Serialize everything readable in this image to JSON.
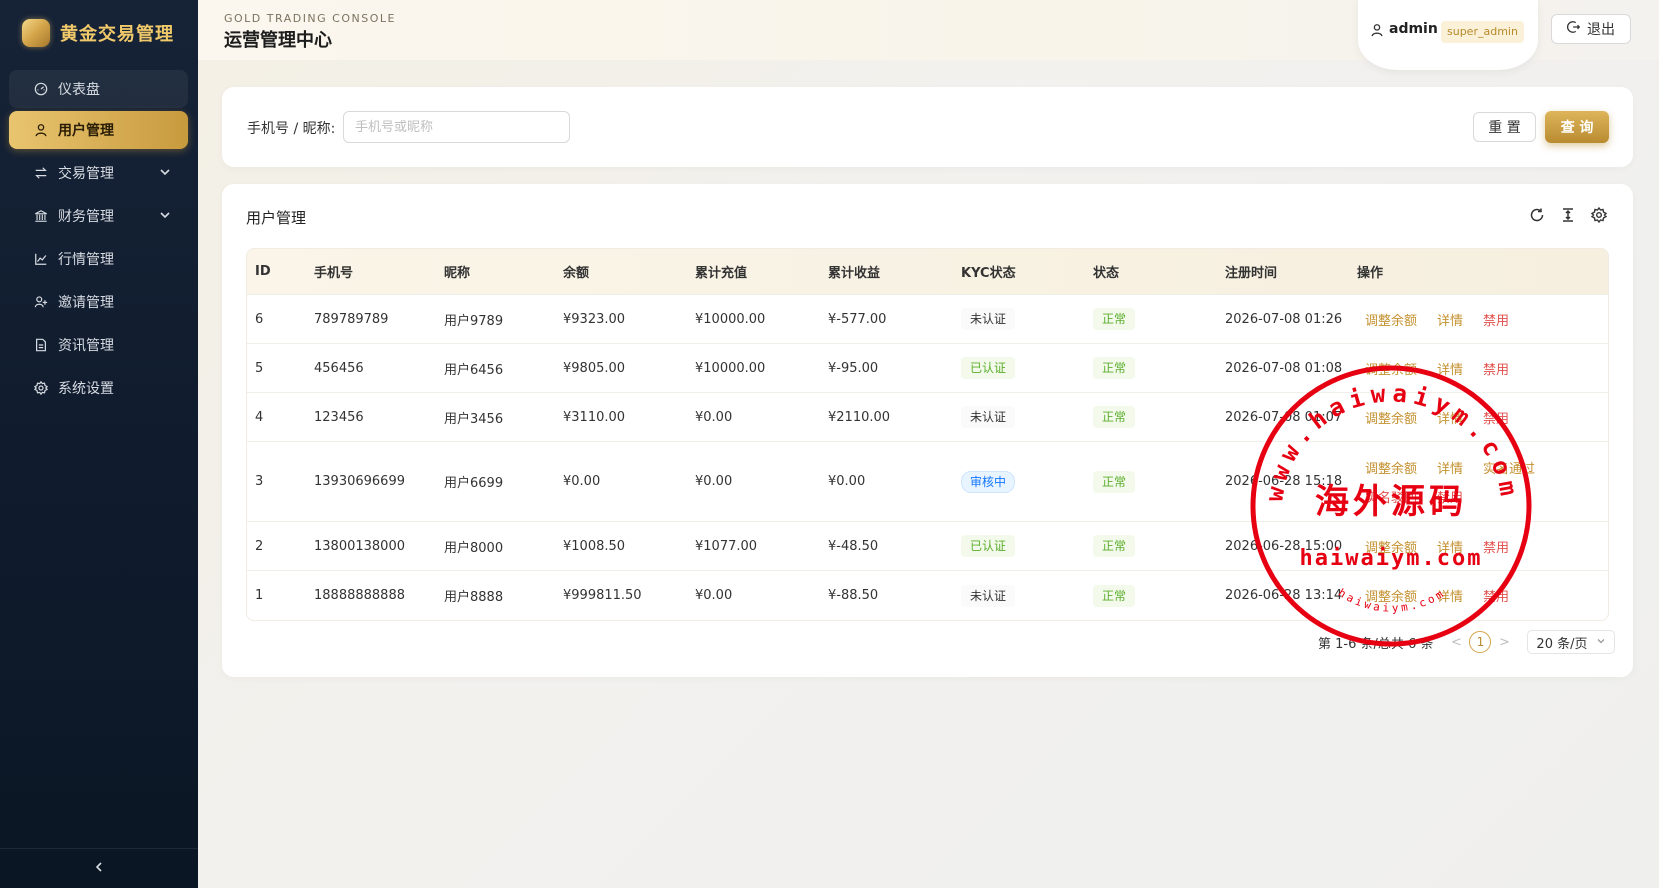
{
  "app": {
    "name": "黄金交易管理"
  },
  "header": {
    "subtitle": "GOLD TRADING CONSOLE",
    "title": "运营管理中心",
    "user": "admin",
    "role": "super_admin",
    "logout": "退出"
  },
  "sidebar": {
    "items": [
      {
        "label": "仪表盘",
        "icon": "dashboard-icon"
      },
      {
        "label": "用户管理",
        "icon": "user-icon"
      },
      {
        "label": "交易管理",
        "icon": "swap-icon"
      },
      {
        "label": "财务管理",
        "icon": "bank-icon"
      },
      {
        "label": "行情管理",
        "icon": "chart-icon"
      },
      {
        "label": "邀请管理",
        "icon": "invite-icon"
      },
      {
        "label": "资讯管理",
        "icon": "file-icon"
      },
      {
        "label": "系统设置",
        "icon": "gear-icon"
      }
    ]
  },
  "search": {
    "label": "手机号 / 昵称:",
    "placeholder": "手机号或昵称",
    "reset": "重 置",
    "query": "查 询"
  },
  "table": {
    "title": "用户管理",
    "columns": [
      "ID",
      "手机号",
      "昵称",
      "余额",
      "累计充值",
      "累计收益",
      "KYC状态",
      "状态",
      "注册时间",
      "操作"
    ],
    "rows": [
      {
        "id": "6",
        "phone": "789789789",
        "nick": "用户9789",
        "balance": "¥9323.00",
        "recharge": "¥10000.00",
        "profit": "¥-577.00",
        "kyc": "未认证",
        "status": "正常",
        "time": "2026-07-08 01:26",
        "ops": [
          "调整余额",
          "详情",
          "禁用"
        ]
      },
      {
        "id": "5",
        "phone": "456456",
        "nick": "用户6456",
        "balance": "¥9805.00",
        "recharge": "¥10000.00",
        "profit": "¥-95.00",
        "kyc": "已认证",
        "status": "正常",
        "time": "2026-07-08 01:08",
        "ops": [
          "调整余额",
          "详情",
          "禁用"
        ]
      },
      {
        "id": "4",
        "phone": "123456",
        "nick": "用户3456",
        "balance": "¥3110.00",
        "recharge": "¥0.00",
        "profit": "¥2110.00",
        "kyc": "未认证",
        "status": "正常",
        "time": "2026-07-08 01:07",
        "ops": [
          "调整余额",
          "详情",
          "禁用"
        ]
      },
      {
        "id": "3",
        "phone": "13930696699",
        "nick": "用户6699",
        "balance": "¥0.00",
        "recharge": "¥0.00",
        "profit": "¥0.00",
        "kyc": "审核中",
        "status": "正常",
        "time": "2026-06-28 15:18",
        "ops": [
          "调整余额",
          "详情",
          "实名通过",
          "实名驳回",
          "禁用"
        ]
      },
      {
        "id": "2",
        "phone": "13800138000",
        "nick": "用户8000",
        "balance": "¥1008.50",
        "recharge": "¥1077.00",
        "profit": "¥-48.50",
        "kyc": "已认证",
        "status": "正常",
        "time": "2026-06-28 15:00",
        "ops": [
          "调整余额",
          "详情",
          "禁用"
        ]
      },
      {
        "id": "1",
        "phone": "18888888888",
        "nick": "用户8888",
        "balance": "¥999811.50",
        "recharge": "¥0.00",
        "profit": "¥-88.50",
        "kyc": "未认证",
        "status": "正常",
        "time": "2026-06-28 13:14",
        "ops": [
          "调整余额",
          "详情",
          "禁用"
        ]
      }
    ]
  },
  "pagination": {
    "summary": "第 1-6 条/总共 6 条",
    "current": "1",
    "page_size": "20 条/页"
  },
  "watermark": {
    "top": "www.haiwaiym.com",
    "center": "海外源码",
    "bottom": "haiwaiym.com",
    "small": "haiwaiym.com"
  },
  "colors": {
    "gold": "#c89a3e",
    "sidebar": "#0f1b2c",
    "red_stamp": "#e60012"
  }
}
